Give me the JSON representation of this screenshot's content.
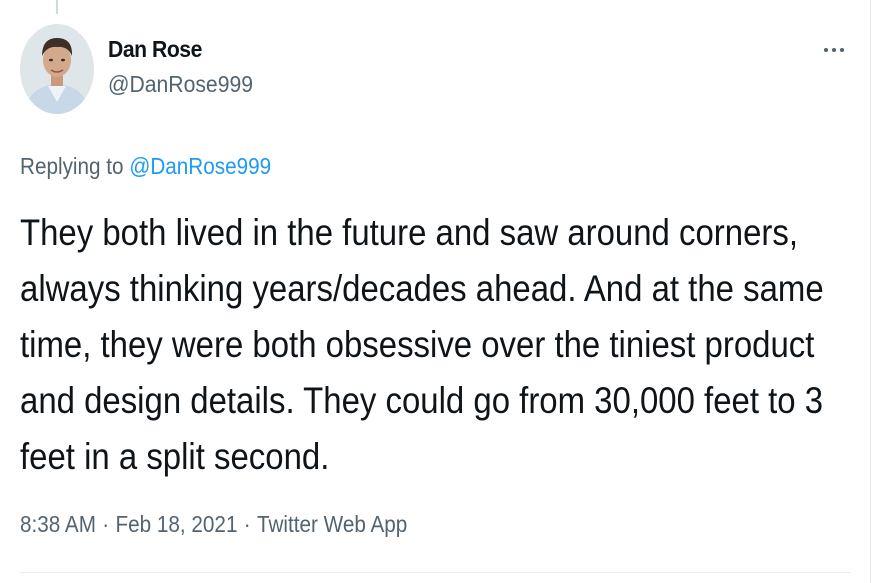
{
  "author": {
    "display_name": "Dan Rose",
    "handle": "@DanRose999"
  },
  "more_icon": "more-horizontal-icon",
  "replying": {
    "prefix": "Replying to",
    "to_handle": "@DanRose999"
  },
  "tweet": {
    "lines": [
      "They both lived in the future and saw around corners,",
      "always thinking years/decades ahead. And at the same",
      "time, they were both obsessive over the tiniest product",
      "and design details. They could go from 30,000 feet to 3",
      "feet in a split second."
    ]
  },
  "meta": {
    "time": "8:38 AM",
    "separator": "·",
    "date": "Feb 18, 2021",
    "source": "Twitter Web App"
  },
  "colors": {
    "link": "#1d9bf0",
    "secondary_text": "#536471",
    "primary_text": "#0f1419"
  }
}
